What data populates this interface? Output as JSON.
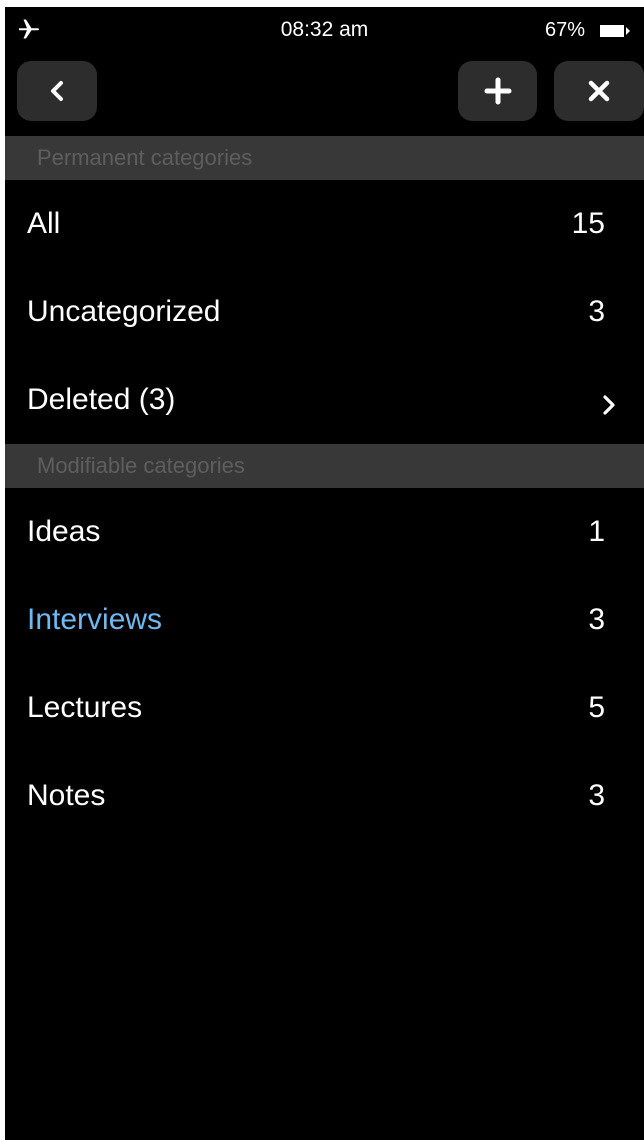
{
  "status_bar": {
    "time": "08:32 am",
    "battery_percent": "67%",
    "battery_level": 0.67,
    "icons": [
      "airplane-icon",
      "battery-icon"
    ]
  },
  "nav_bar": {
    "buttons": [
      {
        "name": "back-button",
        "icon": "chevron-left-icon"
      },
      {
        "name": "add-button",
        "icon": "plus-icon"
      },
      {
        "name": "close-button",
        "icon": "close-icon"
      }
    ]
  },
  "permanent": {
    "header": "Permanent categories",
    "items": [
      {
        "label": "All",
        "count": "15"
      },
      {
        "label": "Uncategorized",
        "count": "3"
      },
      {
        "label": "Deleted (3)",
        "icon": "chevron-right-icon"
      }
    ]
  },
  "modifiable": {
    "header": "Modifiable categories",
    "items": [
      {
        "label": "Ideas",
        "count": "1"
      },
      {
        "label": "Interviews",
        "count": "3",
        "selected": true
      },
      {
        "label": "Lectures",
        "count": "5"
      },
      {
        "label": "Notes",
        "count": "3"
      }
    ]
  },
  "colors": {
    "background": "#000000",
    "button": "#2d2d2d",
    "section_header_bg": "#383838",
    "section_header_text": "#5e5e5e",
    "selected_text": "#6fb8f0",
    "text": "#ffffff"
  }
}
